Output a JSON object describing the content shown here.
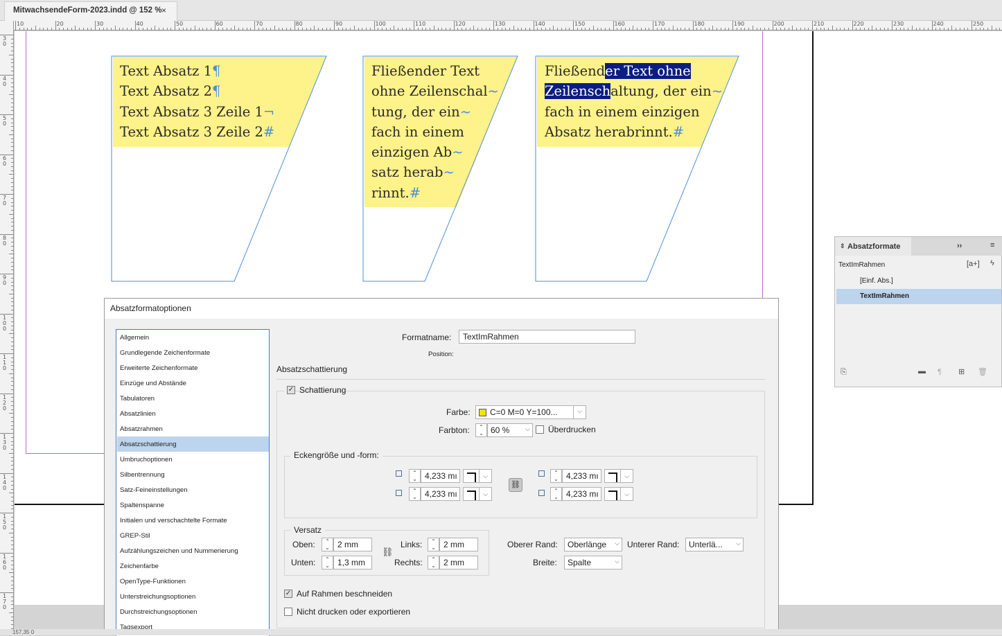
{
  "document": {
    "tab_title": "MitwachsendeForm-2023.indd @ 152 %",
    "close_symbol": "×"
  },
  "rulers": {
    "horizontal": [
      "10",
      "20",
      "30",
      "40",
      "50",
      "60",
      "70",
      "80",
      "90",
      "100",
      "110",
      "120",
      "130",
      "140",
      "150",
      "160",
      "170",
      "180",
      "190",
      "200",
      "210",
      "220",
      "230",
      "240",
      "250"
    ],
    "vertical": [
      "3\n0",
      "4\n0",
      "5\n0",
      "6\n0",
      "7\n0",
      "8\n0",
      "9\n0",
      "1\n0\n0",
      "1\n1\n0",
      "1\n2\n0",
      "1\n3\n0",
      "1\n4\n0",
      "1\n5\n0",
      "1\n6\n0",
      "1\n7\n0"
    ]
  },
  "frames": {
    "frame1": {
      "lines": [
        "Text Absatz 1",
        "Text Absatz 2",
        "Text Absatz 3 Zeile 1",
        "Text Absatz 3 Zeile 2"
      ],
      "marks": [
        "¶",
        "¶",
        "¬",
        "#"
      ]
    },
    "frame2": {
      "lines": [
        "Fließender Text",
        "ohne Zeilenschal",
        "tung, der ein",
        "fach in einem",
        "einzigen Ab",
        "satz herab",
        "rinnt."
      ],
      "marks": [
        "",
        "~",
        "~",
        "",
        "~",
        "~",
        "#"
      ]
    },
    "frame3": {
      "line1_a": "Fließend",
      "line1_b": "er Text ohne",
      "line2_a": "Zeilensch",
      "line2_b": "altung, der ein",
      "line3": "fach in einem einzigen",
      "line4": "Absatz herabrinnt.",
      "marks": [
        "~",
        "#"
      ]
    }
  },
  "dialog": {
    "title": "Absatzformatoptionen",
    "categories": [
      "Allgemein",
      "Grundlegende Zeichenformate",
      "Erweiterte Zeichenformate",
      "Einzüge und Abstände",
      "Tabulatoren",
      "Absatzlinien",
      "Absatzrahmen",
      "Absatzschattierung",
      "Umbruchoptionen",
      "Silbentrennung",
      "Satz-Feineinstellungen",
      "Spaltenspanne",
      "Initialen und verschachtelte Formate",
      "GREP-Stil",
      "Aufzählungszeichen und Nummerierung",
      "Zeichenfarbe",
      "OpenType-Funktionen",
      "Unterstreichungsoptionen",
      "Durchstreichungsoptionen",
      "Tagsexport"
    ],
    "selected_category": "Absatzschattierung",
    "format_name_label": "Formatname:",
    "format_name_value": "TextImRahmen",
    "position_label": "Position:",
    "section_title": "Absatzschattierung",
    "shading_label": "Schattierung",
    "shading_checked": true,
    "color_label": "Farbe:",
    "color_value": "C=0 M=0 Y=100...",
    "color_swatch": "#f2e200",
    "tint_label": "Farbton:",
    "tint_value": "60 %",
    "overprint_label": "Überdrucken",
    "overprint_checked": false,
    "corner_group_label": "Eckengröße und -form:",
    "corner_values": [
      "4,233 mı",
      "4,233 mı",
      "4,233 mı",
      "4,233 mı"
    ],
    "offset_group_label": "Versatz",
    "top_label": "Oben:",
    "top_value": "2 mm",
    "bottom_label": "Unten:",
    "bottom_value": "1,3 mm",
    "left_label": "Links:",
    "left_value": "2 mm",
    "right_label": "Rechts:",
    "right_value": "2 mm",
    "top_edge_label": "Oberer Rand:",
    "top_edge_value": "Oberlänge",
    "bottom_edge_label": "Unterer Rand:",
    "bottom_edge_value": "Unterlä...",
    "width_label": "Breite:",
    "width_value": "Spalte",
    "clip_label": "Auf Rahmen beschneiden",
    "clip_checked": true,
    "noprint_label": "Nicht drucken oder exportieren",
    "noprint_checked": false
  },
  "panel": {
    "title": "Absatzformate",
    "current_style": "TextImRahmen",
    "items": [
      "[Einf. Abs.]",
      "TextImRahmen"
    ],
    "selected_item": "TextImRahmen",
    "collapse_symbol": "››",
    "new_style_symbol": "[a+]"
  },
  "status": {
    "text": "157,35 0"
  },
  "colors": {
    "frame_fill": "#fef28a",
    "frame_stroke": "#4a90d9",
    "selection": "#0a1e82",
    "margin_guide": "#b56ad0",
    "list_selection": "#bcd4ee"
  }
}
